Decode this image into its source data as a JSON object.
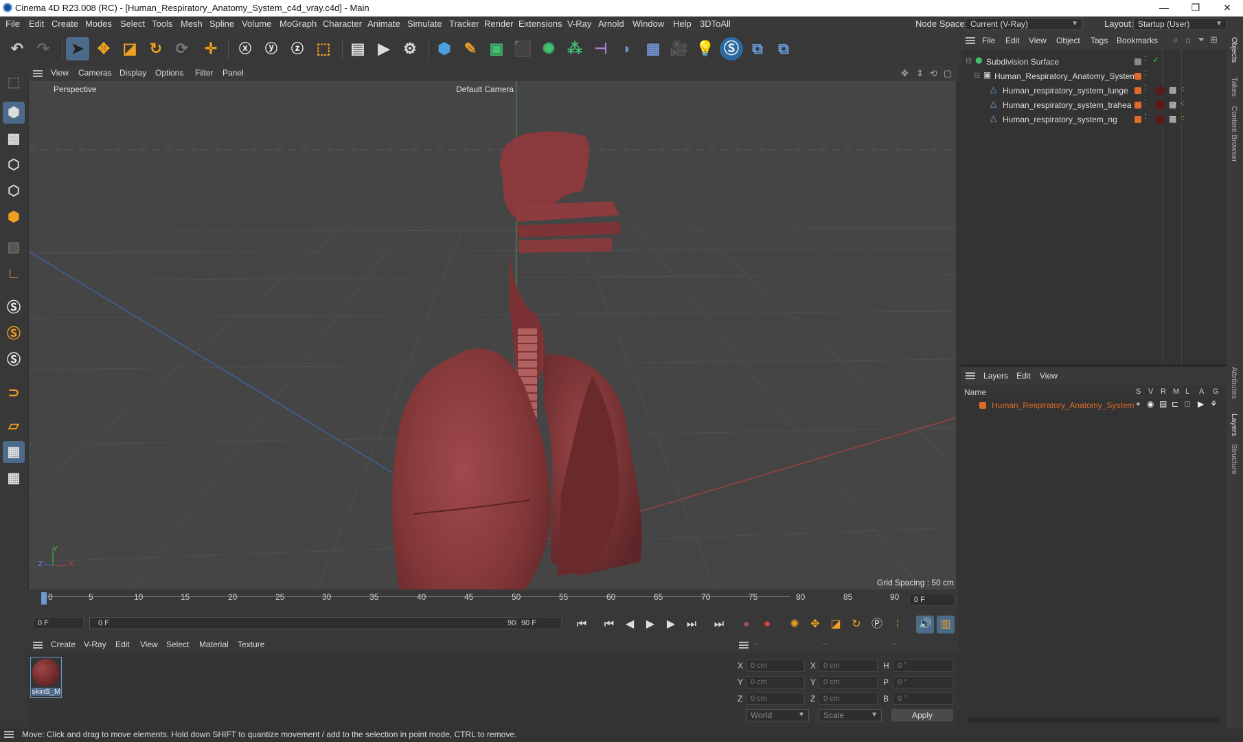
{
  "window": {
    "title": "Cinema 4D R23.008 (RC) - [Human_Respiratory_Anatomy_System_c4d_vray.c4d] - Main",
    "min": "—",
    "max": "❐",
    "close": "✕"
  },
  "menu": [
    "File",
    "Edit",
    "Create",
    "Modes",
    "Select",
    "Tools",
    "Mesh",
    "Spline",
    "Volume",
    "MoGraph",
    "Character",
    "Animate",
    "Simulate",
    "Tracker",
    "Render",
    "Extensions",
    "V-Ray",
    "Arnold",
    "Window",
    "Help",
    "3DToAll"
  ],
  "node_space": {
    "label": "Node Space:",
    "value": "Current (V-Ray)"
  },
  "layout": {
    "label": "Layout:",
    "value": "Startup (User)"
  },
  "viewport": {
    "menu": [
      "View",
      "Cameras",
      "Display",
      "Options",
      "Filter",
      "Panel"
    ],
    "projection": "Perspective",
    "camera": "Default Camera",
    "grid_spacing": "Grid Spacing : 50 cm",
    "axis": {
      "x": "X",
      "y": "Y",
      "z": "Z"
    }
  },
  "timeline": {
    "ticks": [
      "0",
      "5",
      "10",
      "15",
      "20",
      "25",
      "30",
      "35",
      "40",
      "45",
      "50",
      "55",
      "60",
      "65",
      "70",
      "75",
      "80",
      "85",
      "90"
    ],
    "current": "0 F",
    "start": "0 F",
    "range_start": "0 F",
    "range_end": "90 F",
    "end": "90 F"
  },
  "material_panel": {
    "menu": [
      "Create",
      "V-Ray",
      "Edit",
      "View",
      "Select",
      "Material",
      "Texture"
    ],
    "material_name": "skinS_M"
  },
  "coords": {
    "header_a": "--",
    "header_b": "--",
    "header_c": "--",
    "rows": [
      {
        "l1": "X",
        "v1": "0 cm",
        "l2": "X",
        "v2": "0 cm",
        "l3": "H",
        "v3": "0 °"
      },
      {
        "l1": "Y",
        "v1": "0 cm",
        "l2": "Y",
        "v2": "0 cm",
        "l3": "P",
        "v3": "0 °"
      },
      {
        "l1": "Z",
        "v1": "0 cm",
        "l2": "Z",
        "v2": "0 cm",
        "l3": "B",
        "v3": "0 °"
      }
    ],
    "mode": "World",
    "transform": "Scale",
    "apply": "Apply"
  },
  "status": "Move: Click and drag to move elements. Hold down SHIFT to quantize movement / add to the selection in point mode, CTRL to remove.",
  "objects_panel": {
    "menu": [
      "File",
      "Edit",
      "View",
      "Object",
      "Tags",
      "Bookmarks"
    ],
    "items": [
      {
        "name": "Subdivision Surface"
      },
      {
        "name": "Human_Respiratory_Anatomy_System"
      },
      {
        "name": "Human_respiratory_system_lunge"
      },
      {
        "name": "Human_respiratory_system_trahea"
      },
      {
        "name": "Human_respiratory_system_ng"
      }
    ]
  },
  "layers_panel": {
    "menu": [
      "Layers",
      "Edit",
      "View"
    ],
    "columns": {
      "name": "Name",
      "flags": [
        "S",
        "V",
        "R",
        "M",
        "L",
        "A",
        "G"
      ]
    },
    "items": [
      {
        "name": "Human_Respiratory_Anatomy_System",
        "color": "#e06a2a"
      }
    ]
  },
  "side_tabs": [
    "Objects",
    "Takes",
    "Content Browser",
    "Attributes",
    "Layers",
    "Structure"
  ],
  "colors": {
    "accent": "#4c6a8a",
    "layer_orange": "#e06a2a",
    "lung": "#8a3a3c"
  }
}
